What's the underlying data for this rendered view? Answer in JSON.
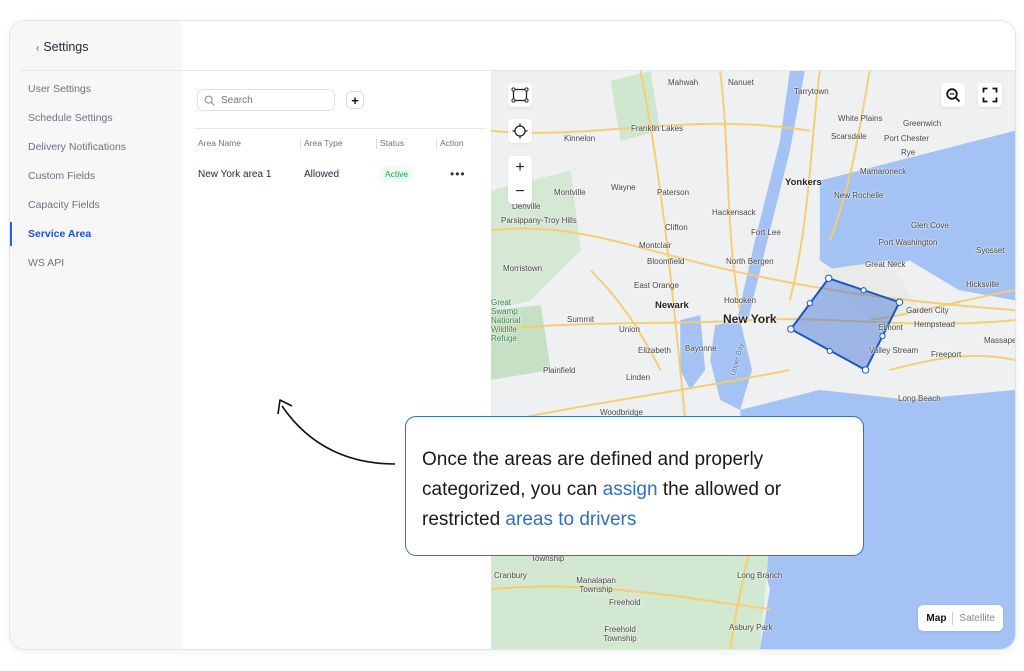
{
  "sidebar": {
    "back_label": "Settings",
    "items": [
      {
        "label": "User Settings",
        "active": false
      },
      {
        "label": "Schedule Settings",
        "active": false
      },
      {
        "label": "Delivery Notifications",
        "active": false
      },
      {
        "label": "Custom Fields",
        "active": false
      },
      {
        "label": "Capacity Fields",
        "active": false
      },
      {
        "label": "Service Area",
        "active": true
      },
      {
        "label": "WS API",
        "active": false
      }
    ]
  },
  "list": {
    "search_placeholder": "Search",
    "add_label": "+",
    "columns": [
      "Area Name",
      "Area Type",
      "Status",
      "Action"
    ],
    "rows": [
      {
        "name": "New York area 1",
        "type": "Allowed",
        "status": "Active",
        "action": "•••"
      }
    ]
  },
  "map": {
    "zoom_in": "+",
    "zoom_out": "−",
    "type_map": "Map",
    "type_satellite": "Satellite",
    "labels": {
      "mahwah": "Mahwah",
      "nanuet": "Nanuet",
      "tarrytown": "Tarrytown",
      "kinnelon": "Kinnelon",
      "franklin_lakes": "Franklin Lakes",
      "white_plains": "White Plains",
      "scarsdale": "Scarsdale",
      "port_chester": "Port Chester",
      "greenwich": "Greenwich",
      "rye": "Rye",
      "montville": "Montville",
      "wayne": "Wayne",
      "paterson": "Paterson",
      "yonkers": "Yonkers",
      "mamaroneck": "Mamaroneck",
      "new_rochelle": "New Rochelle",
      "denville": "Denville",
      "parsippany": "Parsippany-Troy Hills",
      "clifton": "Clifton",
      "hackensack": "Hackensack",
      "fort_lee": "Fort Lee",
      "glen_cove": "Glen Cove",
      "port_washington": "Port Washington",
      "great_neck": "Great Neck",
      "syosset": "Syosset",
      "montclair": "Montclair",
      "bloomfield": "Bloomfield",
      "north_bergen": "North Bergen",
      "morristown": "Morristown",
      "east_orange": "East Orange",
      "hicksville": "Hicksville",
      "newark": "Newark",
      "hoboken": "Hoboken",
      "new_york": "New York",
      "garden_city": "Garden City",
      "hempstead": "Hempstead",
      "elmont": "Elmont",
      "summit": "Summit",
      "union": "Union",
      "swamp": "Great Swamp National Wildlife Refuge",
      "elizabeth": "Elizabeth",
      "bayonne": "Bayonne",
      "valley_stream": "Valley Stream",
      "freeport": "Freeport",
      "massapequa": "Massape",
      "plainfield": "Plainfield",
      "linden": "Linden",
      "long_beach": "Long Beach",
      "woodbridge": "Woodbridge",
      "upper_bay": "Upper Bay",
      "township": "Township",
      "cranbury": "Cranbury",
      "manalapan": "Manalapan Township",
      "long_branch": "Long Branch",
      "freehold": "Freehold",
      "freehold_twp": "Freehold Township",
      "asbury_park": "Asbury Park"
    },
    "polygon_color": "#1a56c4"
  },
  "callout": {
    "text_1": "Once the areas are defined and properly categorized, you can ",
    "highlight_1": "assign",
    "text_2": " the allowed or restricted ",
    "highlight_2": "areas to drivers",
    "accent_color": "#2f6fc4"
  }
}
